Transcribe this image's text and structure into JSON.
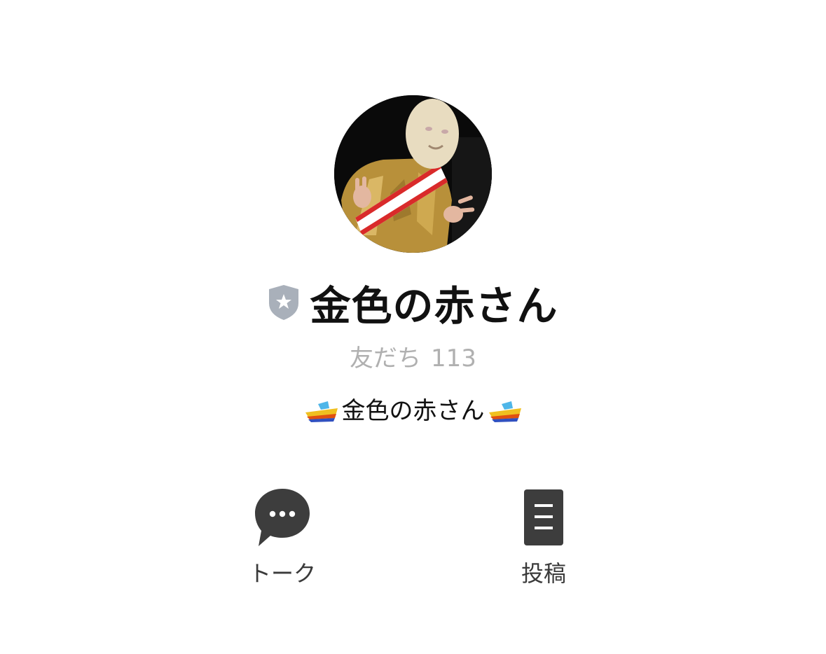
{
  "profile": {
    "avatar_icon": "profile-photo",
    "badge_icon": "shield-star-icon",
    "display_name": "金色の赤さん",
    "friends_label": "友だち",
    "friends_count": "113",
    "status_message": "金色の赤さん",
    "status_decoration_icon": "speedboat-emoji"
  },
  "actions": [
    {
      "label": "トーク",
      "icon": "speech-bubble-icon"
    },
    {
      "label": "投稿",
      "icon": "posts-list-icon"
    }
  ],
  "colors": {
    "background": "#ffffff",
    "text_primary": "#111111",
    "text_secondary": "#b0b0b0",
    "action_icon": "#3d3d3d",
    "badge": "#a9b0ba"
  }
}
